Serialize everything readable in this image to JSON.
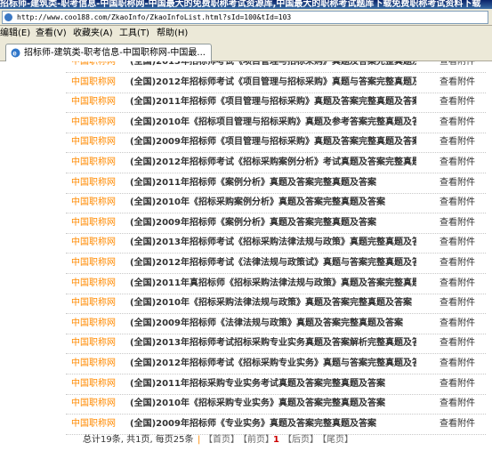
{
  "window": {
    "title": "招标师-建筑类-职考信息-中国职称网-中国最大的免费职称考试资源库,中国最大的职称考试题库下载免费职称考试资料下载"
  },
  "address": {
    "url": "http://www.coo188.com/ZkaoInfo/ZkaoInfoList.html?sId=100&tId=103"
  },
  "menu": {
    "items": [
      "编辑(E)",
      "查看(V)",
      "收藏夹(A)",
      "工具(T)",
      "帮助(H)"
    ]
  },
  "tab": {
    "label": "招标师-建筑类-职考信息-中国职称网-中国最..."
  },
  "list": {
    "rows": [
      {
        "source": "中国职称网",
        "title": "(全国)2013年招标师考试《项目管理与招标采购》真题及答案完整真题及答案",
        "attachment": "查看附件"
      },
      {
        "source": "中国职称网",
        "title": "(全国)2012年招标师考试《项目管理与招标采购》真题与答案完整真题及...",
        "attachment": "查看附件"
      },
      {
        "source": "中国职称网",
        "title": "(全国)2011年招标师《项目管理与招标采购》真题及答案完整真题及答案",
        "attachment": "查看附件"
      },
      {
        "source": "中国职称网",
        "title": "(全国)2010年《招标项目管理与招标采购》真题及参考答案完整真题及答...",
        "attachment": "查看附件"
      },
      {
        "source": "中国职称网",
        "title": "(全国)2009年招标师《项目管理与招标采购》真题及答案完整真题及答案",
        "attachment": "查看附件"
      },
      {
        "source": "中国职称网",
        "title": "(全国)2012年招标师考试《招标采购案例分析》考试真题及答案完整真题...",
        "attachment": "查看附件"
      },
      {
        "source": "中国职称网",
        "title": "(全国)2011年招标师《案例分析》真题及答案完整真题及答案",
        "attachment": "查看附件"
      },
      {
        "source": "中国职称网",
        "title": "(全国)2010年《招标采购案例分析》真题及答案完整真题及答案",
        "attachment": "查看附件"
      },
      {
        "source": "中国职称网",
        "title": "(全国)2009年招标师《案例分析》真题及答案完整真题及答案",
        "attachment": "查看附件"
      },
      {
        "source": "中国职称网",
        "title": "(全国)2013年招标师考试《招标采购法律法规与政策》真题完整真题及答案",
        "attachment": "查看附件"
      },
      {
        "source": "中国职称网",
        "title": "(全国)2012年招标师考试《法律法规与政策试》真题与答案完整真题及答...",
        "attachment": "查看附件"
      },
      {
        "source": "中国职称网",
        "title": "(全国)2011年真招标师《招标采购法律法规与政策》真题及答案完整真题及...",
        "attachment": "查看附件"
      },
      {
        "source": "中国职称网",
        "title": "(全国)2010年《招标采购法律法规与政策》真题及答案完整真题及答案",
        "attachment": "查看附件"
      },
      {
        "source": "中国职称网",
        "title": "(全国)2009年招标师《法律法规与政策》真题及答案完整真题及答案",
        "attachment": "查看附件"
      },
      {
        "source": "中国职称网",
        "title": "(全国)2013年招标师考试招标采购专业实务真题及答案解析完整真题及答案",
        "attachment": "查看附件"
      },
      {
        "source": "中国职称网",
        "title": "(全国)2012年招标师考试《招标采购专业实务》真题与答案完整真题及答...",
        "attachment": "查看附件"
      },
      {
        "source": "中国职称网",
        "title": "(全国)2011年招标采购专业实务考试真题及答案完整真题及答案",
        "attachment": "查看附件"
      },
      {
        "source": "中国职称网",
        "title": "(全国)2010年《招标采购专业实务》真题及答案完整真题及答案",
        "attachment": "查看附件"
      },
      {
        "source": "中国职称网",
        "title": "(全国)2009年招标师《专业实务》真题及答案完整真题及答案",
        "attachment": "查看附件"
      }
    ]
  },
  "pager": {
    "summary": "总计19条, 共1页, 每页25条",
    "first": "【首页】",
    "prev": "【前页】",
    "current": "1",
    "next": "【后页】",
    "last": "【尾页】"
  },
  "colors": {
    "source_text": "#ff8a00",
    "title_text": "#333333",
    "row_divider": "#c8c8c8",
    "current_page": "#cc0000"
  }
}
